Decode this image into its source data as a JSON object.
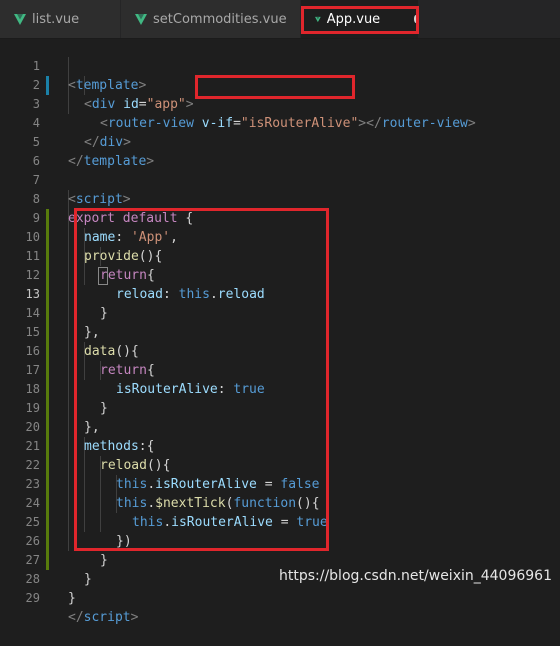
{
  "tabs": [
    {
      "label": "list.vue",
      "icon": "vue-icon",
      "active": false
    },
    {
      "label": "setCommodities.vue",
      "icon": "vue-icon",
      "active": false
    },
    {
      "label": "App.vue",
      "icon": "vue-icon",
      "active": true,
      "dirty": true
    }
  ],
  "editor": {
    "current_line": 13,
    "lines": [
      {
        "n": "1"
      },
      {
        "n": "2"
      },
      {
        "n": "3"
      },
      {
        "n": "4"
      },
      {
        "n": "5"
      },
      {
        "n": "6"
      },
      {
        "n": "7"
      },
      {
        "n": "8"
      },
      {
        "n": "9"
      },
      {
        "n": "10"
      },
      {
        "n": "11"
      },
      {
        "n": "12"
      },
      {
        "n": "13"
      },
      {
        "n": "14"
      },
      {
        "n": "15"
      },
      {
        "n": "16"
      },
      {
        "n": "17"
      },
      {
        "n": "18"
      },
      {
        "n": "19"
      },
      {
        "n": "20"
      },
      {
        "n": "21"
      },
      {
        "n": "22"
      },
      {
        "n": "23"
      },
      {
        "n": "24"
      },
      {
        "n": "25"
      },
      {
        "n": "26"
      },
      {
        "n": "27"
      },
      {
        "n": "28"
      },
      {
        "n": "29"
      }
    ],
    "code": {
      "l1": {
        "a": "<",
        "b": "template",
        "c": ">"
      },
      "l2": {
        "a": "<",
        "b": "div",
        "c": "id",
        "d": "=",
        "e": "\"app\"",
        "f": ">"
      },
      "l3": {
        "a": "<",
        "b": "router-view",
        "c": "v-if",
        "d": "=",
        "e": "\"isRouterAlive\"",
        "f": "></",
        "g": "router-view",
        "h": ">"
      },
      "l4": {
        "a": "</",
        "b": "div",
        "c": ">"
      },
      "l5": {
        "a": "</",
        "b": "template",
        "c": ">"
      },
      "l7": {
        "a": "<",
        "b": "script",
        "c": ">"
      },
      "l8": {
        "a": "export",
        "b": "default",
        "c": "{"
      },
      "l9": {
        "a": "name",
        "b": ":",
        "c": "'App'",
        "d": ","
      },
      "l10": {
        "a": "provide",
        "b": "(){"
      },
      "l11": {
        "a": "return",
        "b": "{"
      },
      "l12": {
        "a": "reload",
        "b": ":",
        "c": "this",
        "d": ".",
        "e": "reload"
      },
      "l13": {
        "a": "}"
      },
      "l14": {
        "a": "},"
      },
      "l15": {
        "a": "data",
        "b": "(){"
      },
      "l16": {
        "a": "return",
        "b": "{"
      },
      "l17": {
        "a": "isRouterAlive",
        "b": ":",
        "c": "true"
      },
      "l18": {
        "a": "}"
      },
      "l19": {
        "a": "},"
      },
      "l20": {
        "a": "methods",
        "b": ":{"
      },
      "l21": {
        "a": "reload",
        "b": "(){"
      },
      "l22": {
        "a": "this",
        "b": ".",
        "c": "isRouterAlive",
        "d": " = ",
        "e": "false"
      },
      "l23": {
        "a": "this",
        "b": ".",
        "c": "$nextTick",
        "d": "(",
        "e": "function",
        "f": "(){"
      },
      "l24": {
        "a": "this",
        "b": ".",
        "c": "isRouterAlive",
        "d": " = ",
        "e": "true"
      },
      "l25": {
        "a": "})"
      },
      "l26": {
        "a": "}"
      },
      "l27": {
        "a": "}"
      },
      "l28": {
        "a": "}"
      },
      "l29": {
        "a": "</",
        "b": "script",
        "c": ">"
      }
    }
  },
  "watermark": "https://blog.csdn.net/weixin_44096961",
  "colors": {
    "background": "#1e1e1e",
    "tag": "#569cd6",
    "attribute": "#9cdcfe",
    "string": "#ce9178",
    "keyword": "#c586c0",
    "function": "#dcdcaa",
    "highlight": "#e0262c"
  }
}
